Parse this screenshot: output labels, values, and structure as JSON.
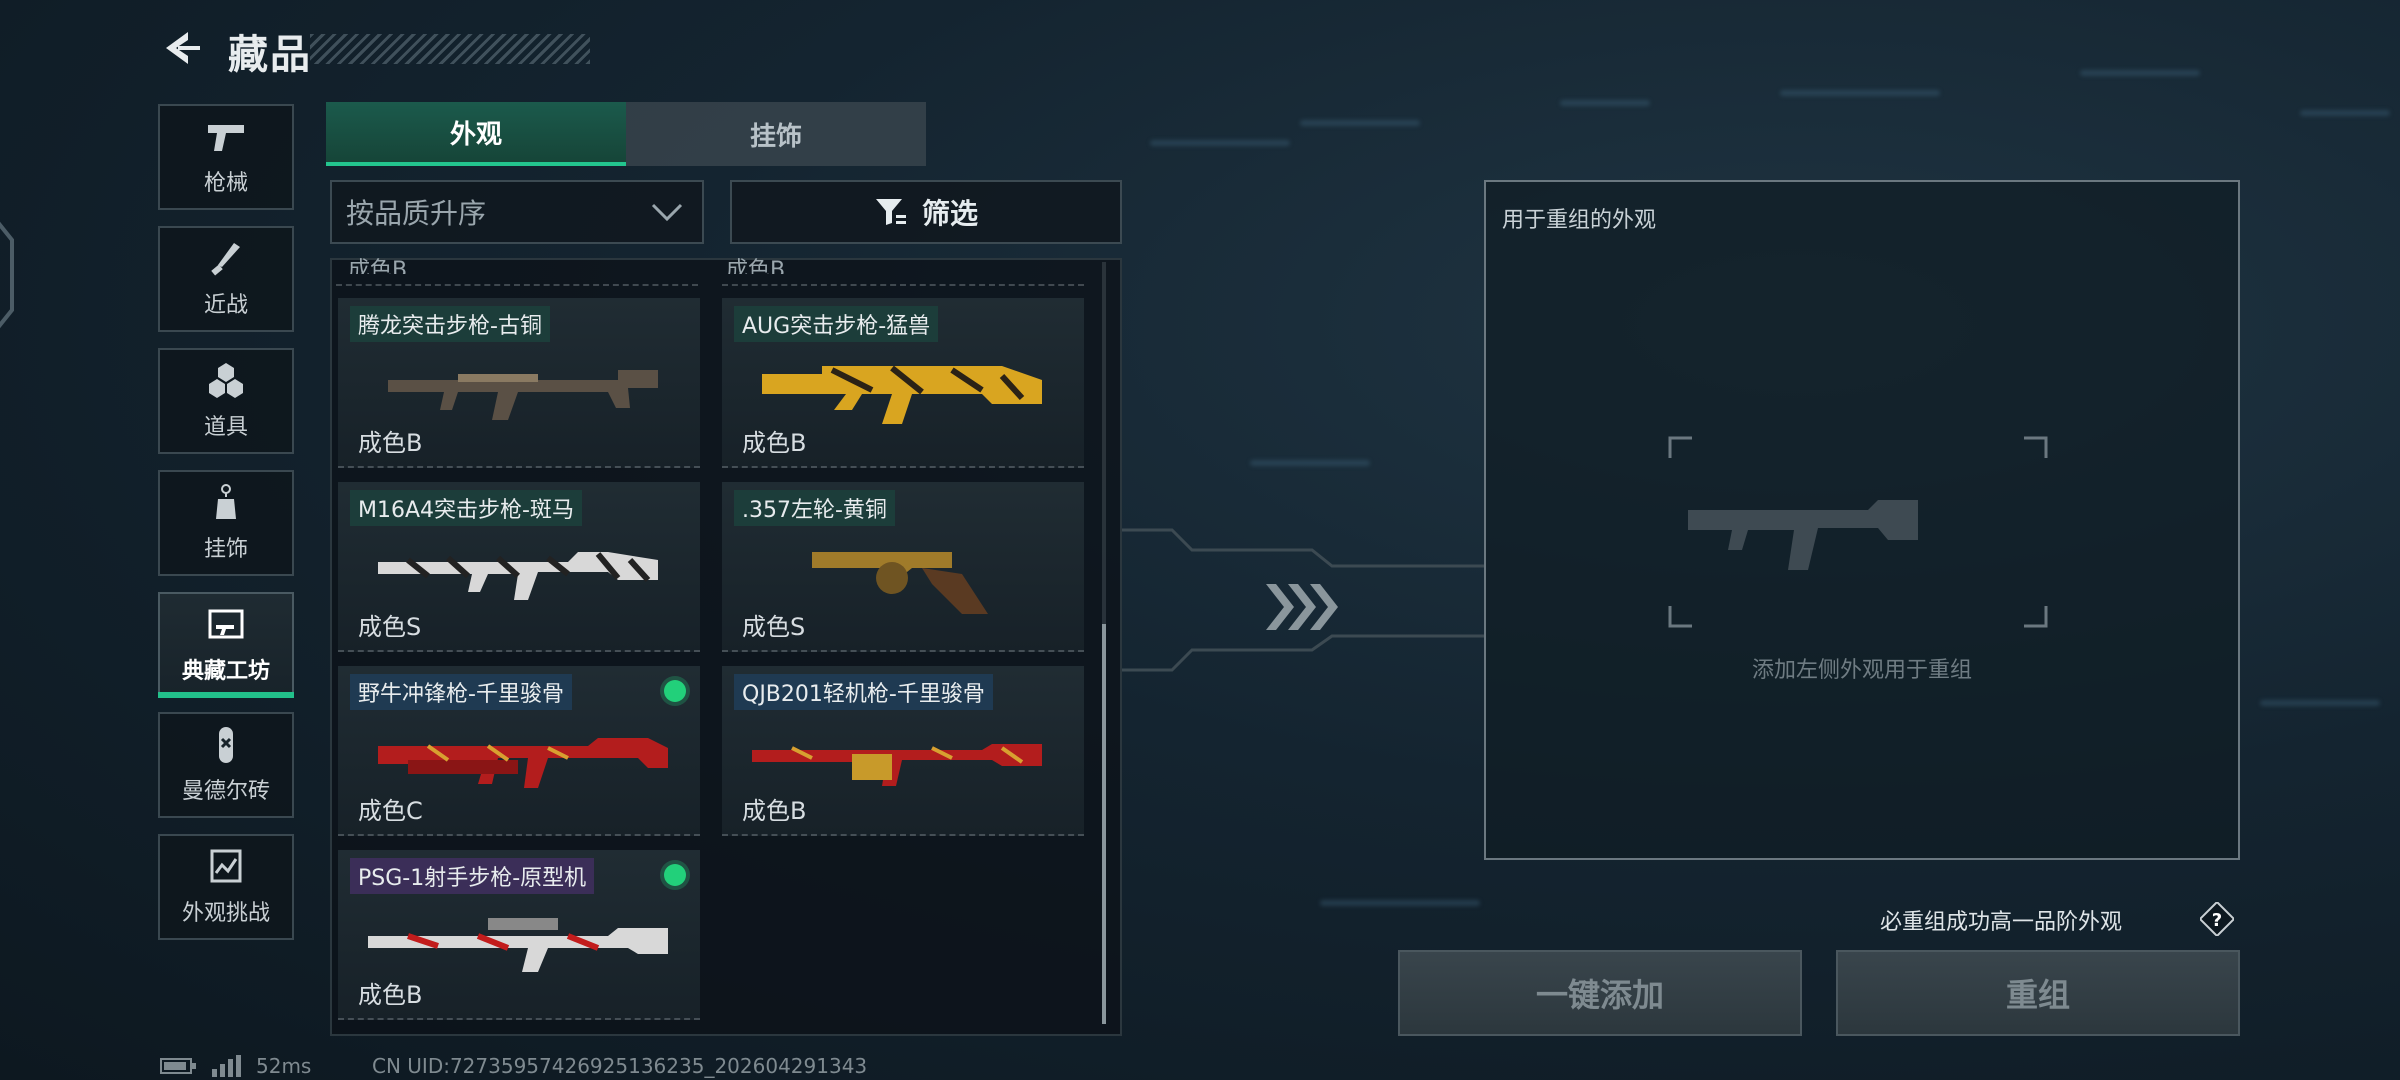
{
  "header": {
    "title": "藏品"
  },
  "nav": [
    {
      "label": "枪械",
      "icon": "pistol-icon"
    },
    {
      "label": "近战",
      "icon": "knife-icon"
    },
    {
      "label": "道具",
      "icon": "grenade-icon"
    },
    {
      "label": "挂饰",
      "icon": "charm-icon"
    },
    {
      "label": "典藏工坊",
      "icon": "workshop-icon",
      "active": true
    },
    {
      "label": "曼德尔砖",
      "icon": "brick-icon"
    },
    {
      "label": "外观挑战",
      "icon": "challenge-icon"
    }
  ],
  "tabs": [
    {
      "label": "外观",
      "active": true
    },
    {
      "label": "挂饰",
      "active": false
    }
  ],
  "sort": {
    "value": "按品质升序"
  },
  "filter": {
    "label": "筛选"
  },
  "list": {
    "cut_labels": [
      "成色B",
      "成色B"
    ],
    "items": [
      {
        "name": "腾龙突击步枪-古铜",
        "grade": "成色B",
        "tag_color": "teal",
        "new": false
      },
      {
        "name": "AUG突击步枪-猛兽",
        "grade": "成色B",
        "tag_color": "teal",
        "new": false
      },
      {
        "name": "M16A4突击步枪-斑马",
        "grade": "成色S",
        "tag_color": "teal",
        "new": false
      },
      {
        "name": ".357左轮-黄铜",
        "grade": "成色S",
        "tag_color": "teal",
        "new": false
      },
      {
        "name": "野牛冲锋枪-千里骏骨",
        "grade": "成色C",
        "tag_color": "blue",
        "new": true
      },
      {
        "name": "QJB201轻机枪-千里骏骨",
        "grade": "成色B",
        "tag_color": "blue",
        "new": false
      },
      {
        "name": "PSG-1射手步枪-原型机",
        "grade": "成色B",
        "tag_color": "purple",
        "new": true
      }
    ]
  },
  "panel": {
    "title": "用于重组的外观",
    "hint": "添加左侧外观用于重组"
  },
  "note": "必重组成功高一品阶外观",
  "buttons": {
    "add_all": "一键添加",
    "recombine": "重组"
  },
  "status": {
    "ping": "52ms",
    "uid": "CN UID:72735957426925136235_202604291343"
  },
  "colors": {
    "accent": "#22c08a",
    "new_dot": "#22d07a"
  }
}
